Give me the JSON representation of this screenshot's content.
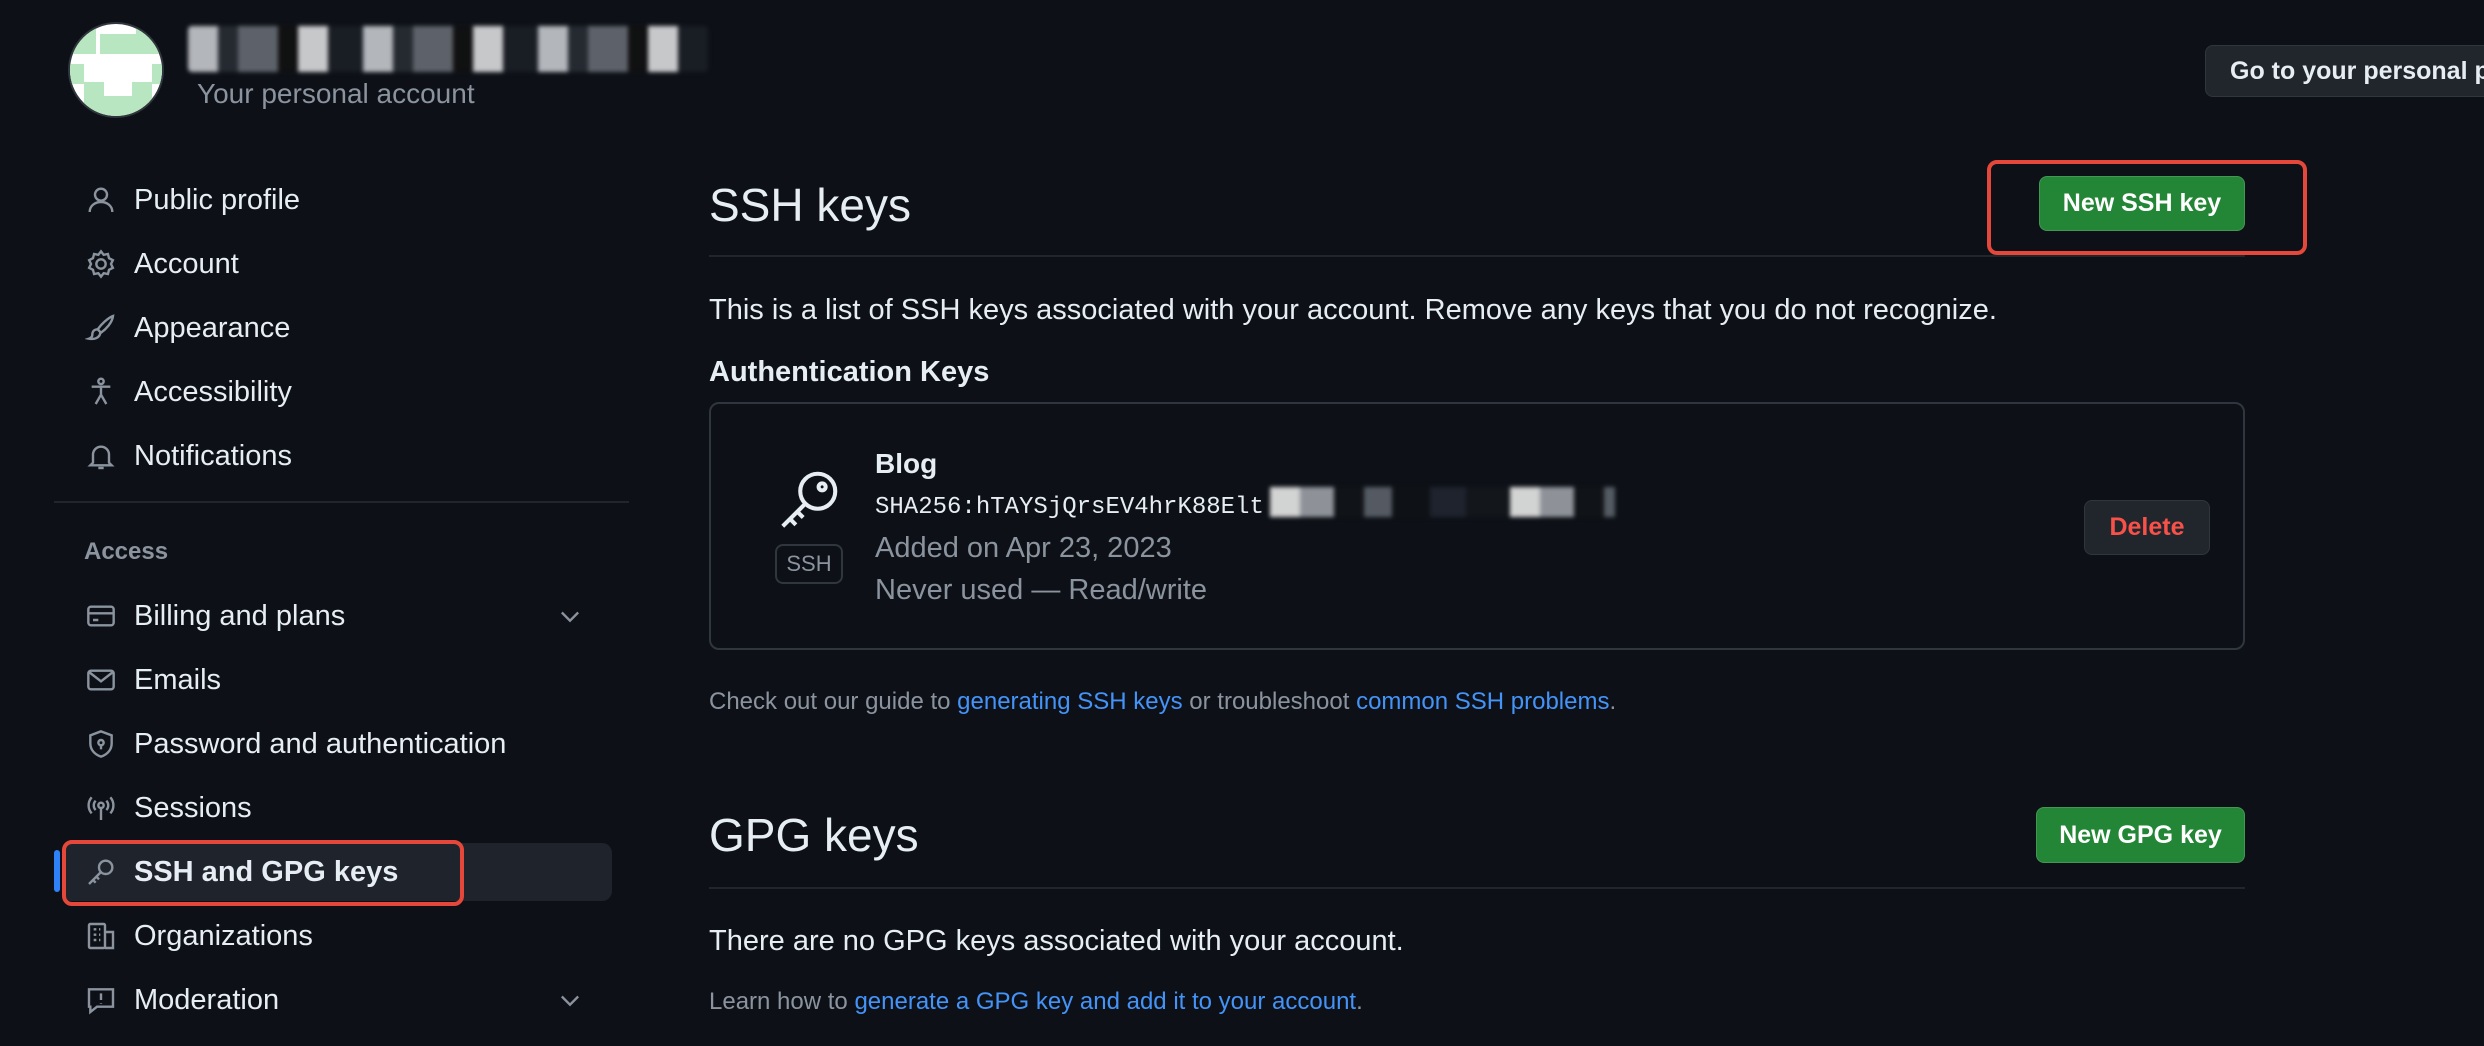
{
  "header": {
    "account_subtitle": "Your personal account",
    "goto_button": "Go to your personal profile"
  },
  "sidebar": {
    "items_top": [
      {
        "label": "Public profile",
        "icon": "person-icon"
      },
      {
        "label": "Account",
        "icon": "gear-icon"
      },
      {
        "label": "Appearance",
        "icon": "paintbrush-icon"
      },
      {
        "label": "Accessibility",
        "icon": "accessibility-icon"
      },
      {
        "label": "Notifications",
        "icon": "bell-icon"
      }
    ],
    "access_label": "Access",
    "items_access": [
      {
        "label": "Billing and plans",
        "icon": "credit-card-icon",
        "expandable": true
      },
      {
        "label": "Emails",
        "icon": "mail-icon"
      },
      {
        "label": "Password and authentication",
        "icon": "shield-lock-icon"
      },
      {
        "label": "Sessions",
        "icon": "broadcast-icon"
      },
      {
        "label": "SSH and GPG keys",
        "icon": "key-icon",
        "active": true
      },
      {
        "label": "Organizations",
        "icon": "organization-icon"
      },
      {
        "label": "Moderation",
        "icon": "report-icon",
        "expandable": true
      }
    ]
  },
  "ssh": {
    "title": "SSH keys",
    "new_button": "New SSH key",
    "description": "This is a list of SSH keys associated with your account. Remove any keys that you do not recognize.",
    "auth_heading": "Authentication Keys",
    "key": {
      "name": "Blog",
      "fingerprint_visible": "SHA256:hTAYSjQrsEV4hrK88Elt",
      "badge": "SSH",
      "added": "Added on Apr 23, 2023",
      "usage": "Never used — Read/write",
      "delete_label": "Delete"
    },
    "guide_prefix": "Check out our guide to ",
    "guide_link1": "generating SSH keys",
    "guide_middle": " or troubleshoot ",
    "guide_link2": "common SSH problems",
    "guide_suffix": "."
  },
  "gpg": {
    "title": "GPG keys",
    "new_button": "New GPG key",
    "empty_text": "There are no GPG keys associated with your account.",
    "learn_prefix": "Learn how to ",
    "learn_link": "generate a GPG key and add it to your account",
    "learn_suffix": "."
  },
  "colors": {
    "background": "#0d1117",
    "accent_green": "#238636",
    "link_blue": "#4493f8",
    "danger_red": "#f85149",
    "highlight_red": "#e5483a",
    "active_bar": "#2f81f7"
  }
}
